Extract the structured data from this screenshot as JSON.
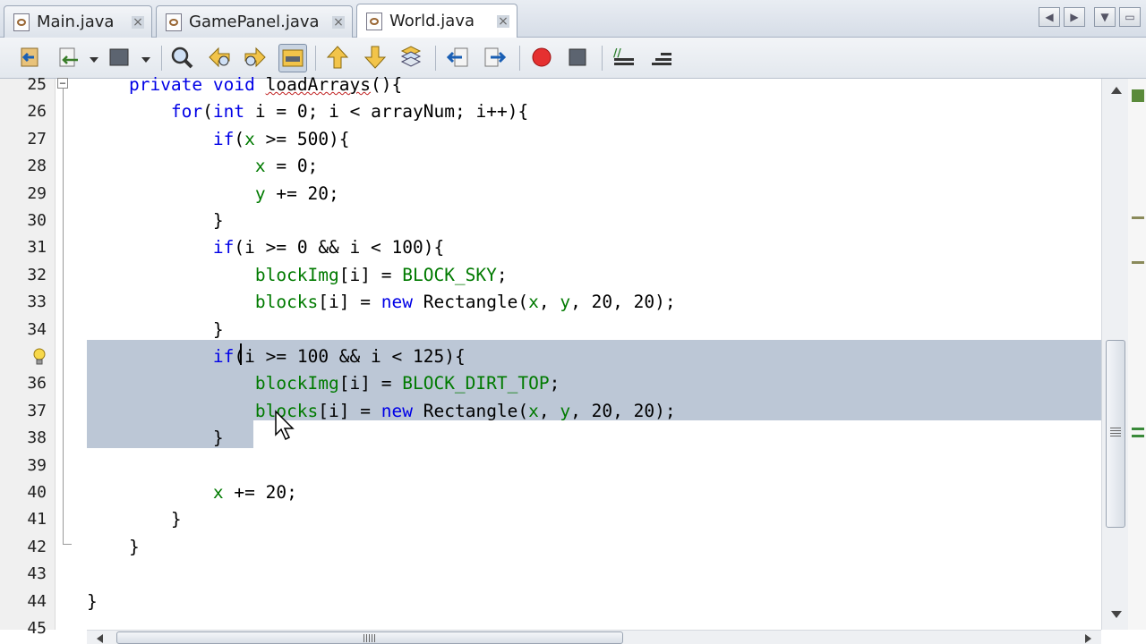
{
  "tabs": [
    {
      "label": "Main.java",
      "active": false
    },
    {
      "label": "GamePanel.java",
      "active": false
    },
    {
      "label": "World.java",
      "active": true
    }
  ],
  "tab_close_glyph": "×",
  "toolbar_icons": [
    "last-edit-icon",
    "back-history-icon",
    "forward-history-icon",
    "find-icon",
    "find-previous-icon",
    "find-next-icon",
    "toggle-highlight-icon",
    "previous-bookmark-icon",
    "next-bookmark-icon",
    "toggle-bookmark-icon",
    "shift-left-icon",
    "shift-right-icon",
    "start-macro-icon",
    "stop-macro-icon",
    "comment-icon",
    "uncomment-icon"
  ],
  "editor": {
    "first_line": 25,
    "selected_lines": [
      35,
      36,
      37,
      38
    ],
    "hint_line": 35,
    "lines": [
      {
        "n": "25",
        "code": "    private void loadArrays(){"
      },
      {
        "n": "26",
        "code": "        for(int i = 0; i < arrayNum; i++){"
      },
      {
        "n": "27",
        "code": "            if(x >= 500){"
      },
      {
        "n": "28",
        "code": "                x = 0;"
      },
      {
        "n": "29",
        "code": "                y += 20;"
      },
      {
        "n": "30",
        "code": "            }"
      },
      {
        "n": "31",
        "code": "            if(i >= 0 && i < 100){"
      },
      {
        "n": "32",
        "code": "                blockImg[i] = BLOCK_SKY;"
      },
      {
        "n": "33",
        "code": "                blocks[i] = new Rectangle(x, y, 20, 20);"
      },
      {
        "n": "34",
        "code": "            }"
      },
      {
        "n": "",
        "code": "            if(i >= 100 && i < 125){"
      },
      {
        "n": "36",
        "code": "                blockImg[i] = BLOCK_DIRT_TOP;"
      },
      {
        "n": "37",
        "code": "                blocks[i] = new Rectangle(x, y, 20, 20);"
      },
      {
        "n": "38",
        "code": "            }"
      },
      {
        "n": "39",
        "code": ""
      },
      {
        "n": "40",
        "code": "            x += 20;"
      },
      {
        "n": "41",
        "code": "        }"
      },
      {
        "n": "42",
        "code": "    }"
      },
      {
        "n": "43",
        "code": ""
      },
      {
        "n": "44",
        "code": "}"
      },
      {
        "n": "45",
        "code": ""
      }
    ]
  },
  "colors": {
    "keyword": "#0000e6",
    "field": "#007a00",
    "selection": "#bcc7d6",
    "gutter": "#f0f0f0"
  }
}
